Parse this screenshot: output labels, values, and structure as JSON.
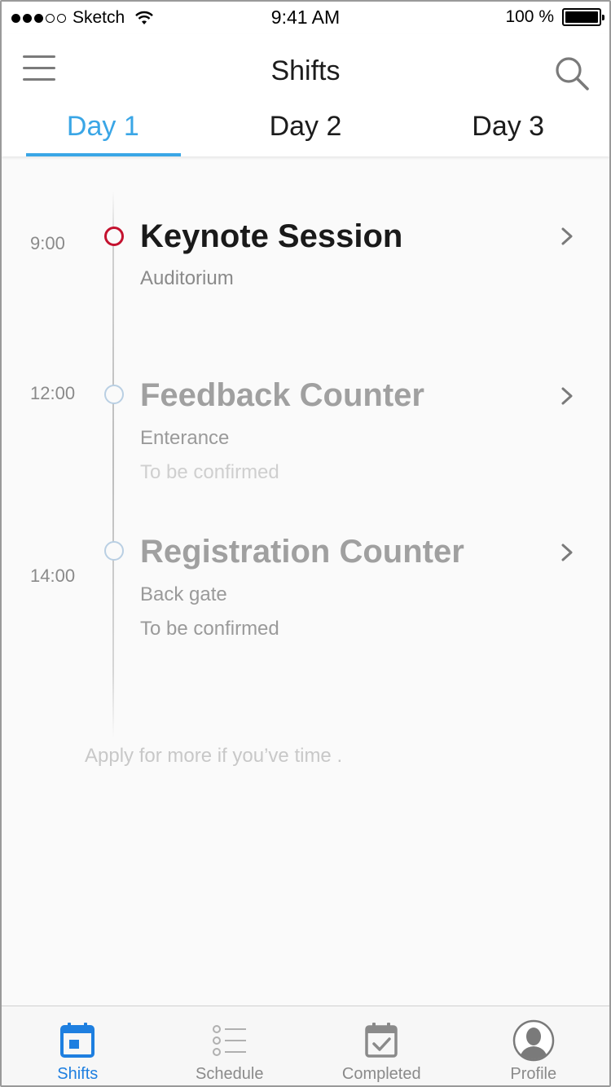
{
  "status_bar": {
    "carrier": "Sketch",
    "time": "9:41 AM",
    "battery": "100 %"
  },
  "nav": {
    "title": "Shifts",
    "menu_icon": "hamburger-menu-icon",
    "search_icon": "search-icon"
  },
  "tabs": [
    {
      "label": "Day 1",
      "active": true
    },
    {
      "label": "Day 2",
      "active": false
    },
    {
      "label": "Day 3",
      "active": false
    }
  ],
  "shifts": [
    {
      "time": "9:00",
      "title": "Keynote Session",
      "location": "Auditorium",
      "note": "",
      "status_color": "#c4122f"
    },
    {
      "time": "12:00",
      "title": "Feedback Counter",
      "location": "Enterance",
      "note": "To be confirmed",
      "status_color": "#b9cfe3"
    },
    {
      "time": "14:00",
      "title": "Registration Counter",
      "location": "Back gate",
      "note": "To be confirmed",
      "status_color": "#b9cfe3"
    }
  ],
  "apply_text": "Apply for more if you’ve time .",
  "tabbar": [
    {
      "label": "Shifts",
      "icon": "calendar-icon",
      "active": true
    },
    {
      "label": "Schedule",
      "icon": "list-icon",
      "active": false
    },
    {
      "label": "Completed",
      "icon": "calendar-check-icon",
      "active": false
    },
    {
      "label": "Profile",
      "icon": "profile-avatar-icon",
      "active": false
    }
  ],
  "colors": {
    "accent": "#3aa6e6",
    "tabbar_active": "#1e7fe0",
    "current_shift": "#c4122f"
  }
}
